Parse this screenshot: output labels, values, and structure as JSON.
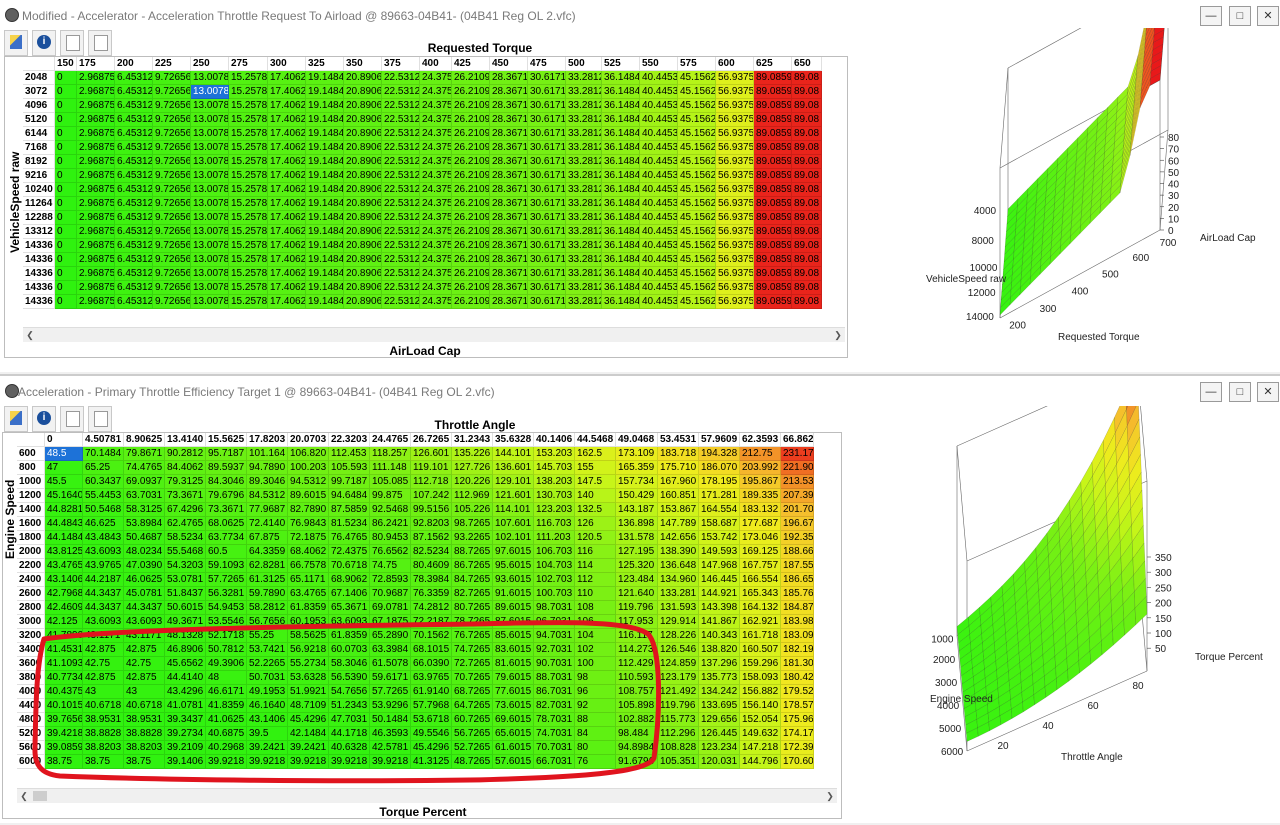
{
  "window1": {
    "title": "Modified - Accelerator - Acceleration Throttle Request To Airload @ 89663-04B41- (04B41 Reg OL 2.vfc)",
    "top_label": "Requested Torque",
    "side_label": "VehicleSpeed raw",
    "bottom_label": "AirLoad Cap",
    "columns": [
      "150",
      "175",
      "200",
      "225",
      "250",
      "275",
      "300",
      "325",
      "350",
      "375",
      "400",
      "425",
      "450",
      "475",
      "500",
      "525",
      "550",
      "575",
      "600",
      "625",
      "650"
    ],
    "rows": [
      "2048",
      "3072",
      "4096",
      "5120",
      "6144",
      "7168",
      "8192",
      "9216",
      "10240",
      "11264",
      "12288",
      "13312",
      "14336",
      "14336",
      "14336",
      "14336",
      "14336"
    ],
    "row_values": [
      "0",
      "2.96875",
      "6.45312",
      "9.72656",
      "13.0078",
      "15.2578",
      "17.4062",
      "19.1484",
      "20.8906",
      "22.5312",
      "24.375",
      "26.2109",
      "28.3671",
      "30.6171",
      "33.2812",
      "36.1484",
      "40.4453",
      "45.1562",
      "56.9375",
      "89.0859",
      "89.08"
    ],
    "selected_value": "13.0078",
    "chart": {
      "z_ticks": [
        "80",
        "70",
        "60",
        "50",
        "40",
        "30",
        "20",
        "10",
        "0"
      ],
      "z_label": "AirLoad Cap",
      "y_ticks": [
        "4000",
        "8000",
        "10000",
        "12000",
        "14000"
      ],
      "y_label": "VehicleSpeed raw",
      "x_ticks": [
        "200",
        "300",
        "400",
        "500",
        "600",
        "700"
      ],
      "x_label": "Requested Torque"
    }
  },
  "window2": {
    "title": "Acceleration - Primary Throttle Efficiency Target 1 @ 89663-04B41- (04B41 Reg OL 2.vfc)",
    "top_label": "Throttle Angle",
    "side_label": "Engine Speed",
    "bottom_label": "Torque Percent",
    "columns": [
      "0",
      "4.50781",
      "8.90625",
      "13.4140",
      "15.5625",
      "17.8203",
      "20.0703",
      "22.3203",
      "24.4765",
      "26.7265",
      "31.2343",
      "35.6328",
      "40.1406",
      "44.5468",
      "49.0468",
      "53.4531",
      "57.9609",
      "62.3593",
      "66.862"
    ],
    "rows": [
      {
        "rpm": "600",
        "v": [
          "48.5",
          "70.1484",
          "79.8671",
          "90.2812",
          "95.7187",
          "101.164",
          "106.820",
          "112.453",
          "118.257",
          "126.601",
          "135.226",
          "144.101",
          "153.203",
          "162.5",
          "173.109",
          "183.718",
          "194.328",
          "212.75",
          "231.17"
        ]
      },
      {
        "rpm": "800",
        "v": [
          "47",
          "65.25",
          "74.4765",
          "84.4062",
          "89.5937",
          "94.7890",
          "100.203",
          "105.593",
          "111.148",
          "119.101",
          "127.726",
          "136.601",
          "145.703",
          "155",
          "165.359",
          "175.710",
          "186.070",
          "203.992",
          "221.90"
        ]
      },
      {
        "rpm": "1000",
        "v": [
          "45.5",
          "60.3437",
          "69.0937",
          "79.3125",
          "84.3046",
          "89.3046",
          "94.5312",
          "99.7187",
          "105.085",
          "112.718",
          "120.226",
          "129.101",
          "138.203",
          "147.5",
          "157.734",
          "167.960",
          "178.195",
          "195.867",
          "213.53"
        ]
      },
      {
        "rpm": "1200",
        "v": [
          "45.1640",
          "55.4453",
          "63.7031",
          "73.3671",
          "79.6796",
          "84.5312",
          "89.6015",
          "94.6484",
          "99.875",
          "107.242",
          "112.969",
          "121.601",
          "130.703",
          "140",
          "150.429",
          "160.851",
          "171.281",
          "189.335",
          "207.39"
        ]
      },
      {
        "rpm": "1400",
        "v": [
          "44.8281",
          "50.5468",
          "58.3125",
          "67.4296",
          "73.3671",
          "77.9687",
          "82.7890",
          "87.5859",
          "92.5468",
          "99.5156",
          "105.226",
          "114.101",
          "123.203",
          "132.5",
          "143.187",
          "153.867",
          "164.554",
          "183.132",
          "201.70"
        ]
      },
      {
        "rpm": "1600",
        "v": [
          "44.4843",
          "46.625",
          "53.8984",
          "62.4765",
          "68.0625",
          "72.4140",
          "76.9843",
          "81.5234",
          "86.2421",
          "92.8203",
          "98.7265",
          "107.601",
          "116.703",
          "126",
          "136.898",
          "147.789",
          "158.687",
          "177.687",
          "196.67"
        ]
      },
      {
        "rpm": "1800",
        "v": [
          "44.1484",
          "43.4843",
          "50.4687",
          "58.5234",
          "63.7734",
          "67.875",
          "72.1875",
          "76.4765",
          "80.9453",
          "87.1562",
          "93.2265",
          "102.101",
          "111.203",
          "120.5",
          "131.578",
          "142.656",
          "153.742",
          "173.046",
          "192.35"
        ]
      },
      {
        "rpm": "2000",
        "v": [
          "43.8125",
          "43.6093",
          "48.0234",
          "55.5468",
          "60.5",
          "64.3359",
          "68.4062",
          "72.4375",
          "76.6562",
          "82.5234",
          "88.7265",
          "97.6015",
          "106.703",
          "116",
          "127.195",
          "138.390",
          "149.593",
          "169.125",
          "188.66"
        ]
      },
      {
        "rpm": "2200",
        "v": [
          "43.4765",
          "43.9765",
          "47.0390",
          "54.3203",
          "59.1093",
          "62.8281",
          "66.7578",
          "70.6718",
          "74.75",
          "80.4609",
          "86.7265",
          "95.6015",
          "104.703",
          "114",
          "125.320",
          "136.648",
          "147.968",
          "167.757",
          "187.55"
        ]
      },
      {
        "rpm": "2400",
        "v": [
          "43.1406",
          "44.2187",
          "46.0625",
          "53.0781",
          "57.7265",
          "61.3125",
          "65.1171",
          "68.9062",
          "72.8593",
          "78.3984",
          "84.7265",
          "93.6015",
          "102.703",
          "112",
          "123.484",
          "134.960",
          "146.445",
          "166.554",
          "186.65"
        ]
      },
      {
        "rpm": "2600",
        "v": [
          "42.7968",
          "44.3437",
          "45.0781",
          "51.8437",
          "56.3281",
          "59.7890",
          "63.4765",
          "67.1406",
          "70.9687",
          "76.3359",
          "82.7265",
          "91.6015",
          "100.703",
          "110",
          "121.640",
          "133.281",
          "144.921",
          "165.343",
          "185.76"
        ]
      },
      {
        "rpm": "2800",
        "v": [
          "42.4609",
          "44.3437",
          "44.3437",
          "50.6015",
          "54.9453",
          "58.2812",
          "61.8359",
          "65.3671",
          "69.0781",
          "74.2812",
          "80.7265",
          "89.6015",
          "98.7031",
          "108",
          "119.796",
          "131.593",
          "143.398",
          "164.132",
          "184.87"
        ]
      },
      {
        "rpm": "3000",
        "v": [
          "42.125",
          "43.6093",
          "43.6093",
          "49.3671",
          "53.5546",
          "56.7656",
          "60.1953",
          "63.6093",
          "67.1875",
          "72.2187",
          "78.7265",
          "87.6015",
          "96.7031",
          "106",
          "117.953",
          "129.914",
          "141.867",
          "162.921",
          "183.98"
        ]
      },
      {
        "rpm": "3200",
        "v": [
          "41.7890",
          "43.1171",
          "43.1171",
          "48.1328",
          "52.1718",
          "55.25",
          "58.5625",
          "61.8359",
          "65.2890",
          "70.1562",
          "76.7265",
          "85.6015",
          "94.7031",
          "104",
          "116.117",
          "128.226",
          "140.343",
          "161.718",
          "183.09"
        ]
      },
      {
        "rpm": "3400",
        "v": [
          "41.4531",
          "42.875",
          "42.875",
          "46.8906",
          "50.7812",
          "53.7421",
          "56.9218",
          "60.0703",
          "63.3984",
          "68.1015",
          "74.7265",
          "83.6015",
          "92.7031",
          "102",
          "114.273",
          "126.546",
          "138.820",
          "160.507",
          "182.19"
        ]
      },
      {
        "rpm": "3600",
        "v": [
          "41.1093",
          "42.75",
          "42.75",
          "45.6562",
          "49.3906",
          "52.2265",
          "55.2734",
          "58.3046",
          "61.5078",
          "66.0390",
          "72.7265",
          "81.6015",
          "90.7031",
          "100",
          "112.429",
          "124.859",
          "137.296",
          "159.296",
          "181.30"
        ]
      },
      {
        "rpm": "3800",
        "v": [
          "40.7734",
          "42.875",
          "42.875",
          "44.4140",
          "48",
          "50.7031",
          "53.6328",
          "56.5390",
          "59.6171",
          "63.9765",
          "70.7265",
          "79.6015",
          "88.7031",
          "98",
          "110.593",
          "123.179",
          "135.773",
          "158.093",
          "180.42"
        ]
      },
      {
        "rpm": "4000",
        "v": [
          "40.4375",
          "43",
          "43",
          "43.4296",
          "46.6171",
          "49.1953",
          "51.9921",
          "54.7656",
          "57.7265",
          "61.9140",
          "68.7265",
          "77.6015",
          "86.7031",
          "96",
          "108.757",
          "121.492",
          "134.242",
          "156.882",
          "179.52"
        ]
      },
      {
        "rpm": "4400",
        "v": [
          "40.1015",
          "40.6718",
          "40.6718",
          "41.0781",
          "41.8359",
          "46.1640",
          "48.7109",
          "51.2343",
          "53.9296",
          "57.7968",
          "64.7265",
          "73.6015",
          "82.7031",
          "92",
          "105.898",
          "119.796",
          "133.695",
          "156.140",
          "178.57"
        ]
      },
      {
        "rpm": "4800",
        "v": [
          "39.7656",
          "38.9531",
          "38.9531",
          "39.3437",
          "41.0625",
          "43.1406",
          "45.4296",
          "47.7031",
          "50.1484",
          "53.6718",
          "60.7265",
          "69.6015",
          "78.7031",
          "88",
          "102.882",
          "115.773",
          "129.656",
          "152.054",
          "175.96"
        ]
      },
      {
        "rpm": "5200",
        "v": [
          "39.4218",
          "38.8828",
          "38.8828",
          "39.2734",
          "40.6875",
          "39.5",
          "42.1484",
          "44.1718",
          "46.3593",
          "49.5546",
          "56.7265",
          "65.6015",
          "74.7031",
          "84",
          "98.484",
          "112.296",
          "126.445",
          "149.632",
          "174.17"
        ]
      },
      {
        "rpm": "5600",
        "v": [
          "39.0859",
          "38.8203",
          "38.8203",
          "39.2109",
          "40.2968",
          "39.2421",
          "39.2421",
          "40.6328",
          "42.5781",
          "45.4296",
          "52.7265",
          "61.6015",
          "70.7031",
          "80",
          "94.8984",
          "108.828",
          "123.234",
          "147.218",
          "172.39"
        ]
      },
      {
        "rpm": "6000",
        "v": [
          "38.75",
          "38.75",
          "38.75",
          "39.1406",
          "39.9218",
          "39.9218",
          "39.9218",
          "39.9218",
          "39.9218",
          "41.3125",
          "48.7265",
          "57.6015",
          "66.7031",
          "76",
          "91.6796",
          "105.351",
          "120.031",
          "144.796",
          "170.60"
        ]
      }
    ],
    "selected_value": "48.5",
    "chart": {
      "z_ticks": [
        "350",
        "300",
        "250",
        "200",
        "150",
        "100",
        "50"
      ],
      "z_label": "Torque Percent",
      "y_ticks": [
        "1000",
        "2000",
        "3000",
        "4000",
        "5000",
        "6000"
      ],
      "y_label": "Engine Speed",
      "x_ticks": [
        "20",
        "40",
        "60",
        "80"
      ],
      "x_label": "Throttle Angle"
    }
  },
  "annotation": {
    "shape": "red-freehand-outline",
    "color": "#e0141e"
  },
  "colors": {
    "green": "#2ff20f",
    "lime": "#8ff01a",
    "yellow": "#e8f51b",
    "orange": "#f5b42a",
    "red": "#e8191a",
    "select": "#1d72d8"
  }
}
